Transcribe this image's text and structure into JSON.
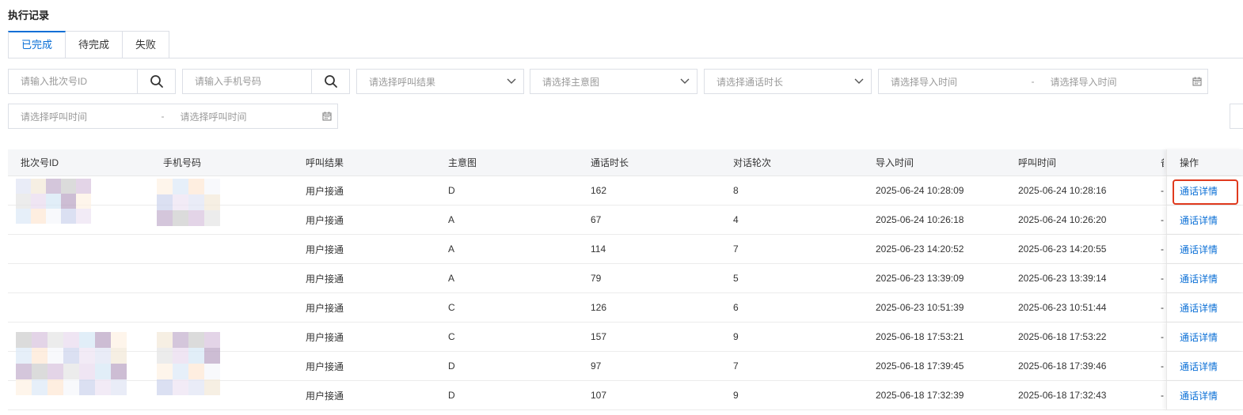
{
  "page": {
    "title": "执行记录"
  },
  "tabs": [
    {
      "label": "已完成",
      "active": true
    },
    {
      "label": "待完成",
      "active": false
    },
    {
      "label": "失败",
      "active": false
    }
  ],
  "filters": {
    "batch_id_placeholder": "请输入批次号ID",
    "phone_placeholder": "请输入手机号码",
    "call_result_placeholder": "请选择呼叫结果",
    "intent_placeholder": "请选择主意图",
    "duration_placeholder": "请选择通话时长",
    "import_start_placeholder": "请选择导入时间",
    "import_end_placeholder": "请选择导入时间",
    "call_start_placeholder": "请选择呼叫时间",
    "call_end_placeholder": "请选择呼叫时间",
    "range_sep": "-"
  },
  "table": {
    "columns": [
      "批次号ID",
      "手机号码",
      "呼叫结果",
      "主意图",
      "通话时长",
      "对话轮次",
      "导入时间",
      "呼叫时间",
      "备",
      "操作"
    ],
    "action_label": "通话详情",
    "rows": [
      {
        "batch_id": "",
        "phone": "",
        "result": "用户接通",
        "intent": "D",
        "duration": "162",
        "turns": "8",
        "import_time": "2025-06-24 10:28:09",
        "call_time": "2025-06-24 10:28:16",
        "remark": "-"
      },
      {
        "batch_id": "",
        "phone": "",
        "result": "用户接通",
        "intent": "A",
        "duration": "67",
        "turns": "4",
        "import_time": "2025-06-24 10:26:18",
        "call_time": "2025-06-24 10:26:20",
        "remark": "-"
      },
      {
        "batch_id": "",
        "phone": "",
        "result": "用户接通",
        "intent": "A",
        "duration": "114",
        "turns": "7",
        "import_time": "2025-06-23 14:20:52",
        "call_time": "2025-06-23 14:20:55",
        "remark": "-"
      },
      {
        "batch_id": "",
        "phone": "",
        "result": "用户接通",
        "intent": "A",
        "duration": "79",
        "turns": "5",
        "import_time": "2025-06-23 13:39:09",
        "call_time": "2025-06-23 13:39:14",
        "remark": "-"
      },
      {
        "batch_id": "",
        "phone": "",
        "result": "用户接通",
        "intent": "C",
        "duration": "126",
        "turns": "6",
        "import_time": "2025-06-23 10:51:39",
        "call_time": "2025-06-23 10:51:44",
        "remark": "-"
      },
      {
        "batch_id": "",
        "phone": "",
        "result": "用户接通",
        "intent": "C",
        "duration": "157",
        "turns": "9",
        "import_time": "2025-06-18 17:53:21",
        "call_time": "2025-06-18 17:53:22",
        "remark": "-"
      },
      {
        "batch_id": "",
        "phone": "",
        "result": "用户接通",
        "intent": "D",
        "duration": "97",
        "turns": "7",
        "import_time": "2025-06-18 17:39:45",
        "call_time": "2025-06-18 17:39:46",
        "remark": "-"
      },
      {
        "batch_id": "",
        "phone": "",
        "result": "用户接通",
        "intent": "D",
        "duration": "107",
        "turns": "9",
        "import_time": "2025-06-18 17:32:39",
        "call_time": "2025-06-18 17:32:43",
        "remark": "-"
      }
    ]
  },
  "colors": {
    "accent": "#0a6fd6",
    "highlight_border": "#e03a1e"
  },
  "icons": [
    "search-icon",
    "chevron-down-icon",
    "calendar-icon"
  ]
}
